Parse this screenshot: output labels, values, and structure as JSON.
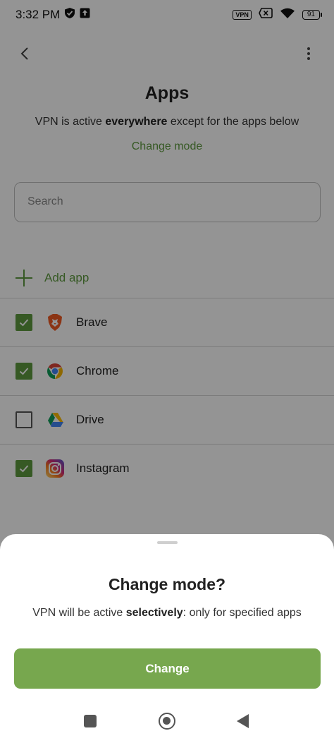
{
  "status_bar": {
    "time": "3:32 PM",
    "vpn_label": "VPN",
    "battery_level": "91",
    "icons": [
      "shield-check-icon",
      "upload-box-icon",
      "vpn-badge-icon",
      "no-sim-icon",
      "wifi-icon",
      "battery-icon"
    ]
  },
  "header": {
    "title": "Apps",
    "subtitle_pre": "VPN is active ",
    "subtitle_bold": "everywhere",
    "subtitle_post": " except for the apps below",
    "change_mode_link": "Change mode"
  },
  "search": {
    "placeholder": "Search",
    "value": ""
  },
  "add_app": {
    "label": "Add app"
  },
  "apps": [
    {
      "name": "Brave",
      "checked": true,
      "icon": "brave-icon"
    },
    {
      "name": "Chrome",
      "checked": true,
      "icon": "chrome-icon"
    },
    {
      "name": "Drive",
      "checked": false,
      "icon": "drive-icon"
    },
    {
      "name": "Instagram",
      "checked": true,
      "icon": "instagram-icon"
    }
  ],
  "sheet": {
    "title": "Change mode?",
    "text_pre": "VPN will be active ",
    "text_bold": "selectively",
    "text_post": ": only for specified apps",
    "button_label": "Change"
  },
  "colors": {
    "accent": "#5e9a3f",
    "button": "#77a74e"
  }
}
